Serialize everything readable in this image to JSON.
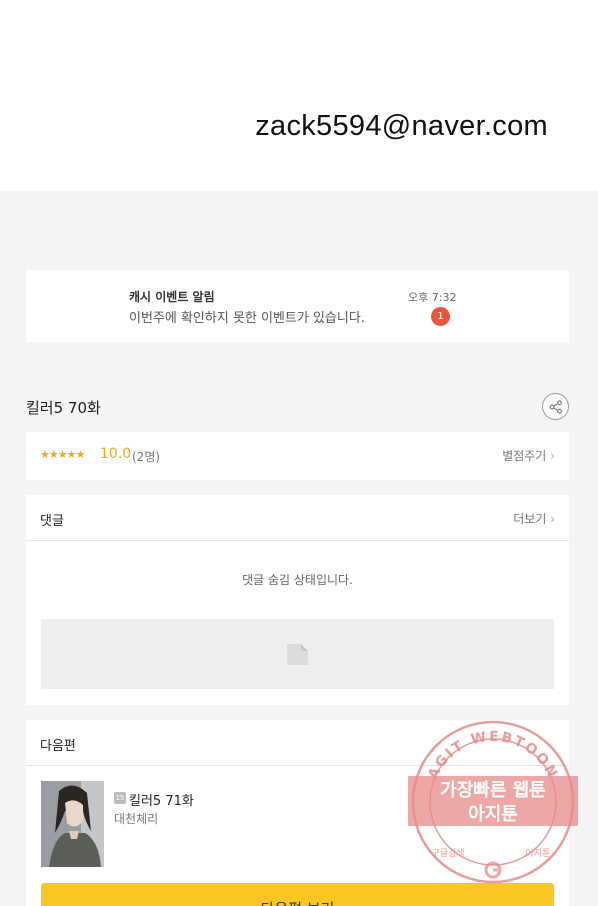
{
  "header": {
    "email": "zack5594@naver.com"
  },
  "notification": {
    "title": "캐시 이벤트 알림",
    "body": "이번주에 확인하지 못한 이벤트가 있습니다.",
    "time": "오후 7:32",
    "badge": "1"
  },
  "episode": {
    "title": "킬러5 70화",
    "share_icon": "share-icon"
  },
  "rating": {
    "stars": "★★★★★",
    "score": "10.0",
    "votes": "(2명)",
    "rate_label": "별점주기",
    "star_color": "#f5a623"
  },
  "comments": {
    "title": "댓글",
    "more_label": "더보기",
    "hidden_message": "댓글 숨김 상태입니다."
  },
  "next_episode": {
    "section_title": "다음편",
    "badge": "15",
    "title": "킬러5 71화",
    "author": "대천체리",
    "button_label": "다음편 보기",
    "button_color": "#f9c623"
  },
  "watermark": {
    "arc_text": "AGIT WEBTOON",
    "line1": "가장빠른 웹툰",
    "line2": "아지툰",
    "bottom_left": "구글검색",
    "bottom_right": "아지툰",
    "color": "#e88a8a"
  }
}
